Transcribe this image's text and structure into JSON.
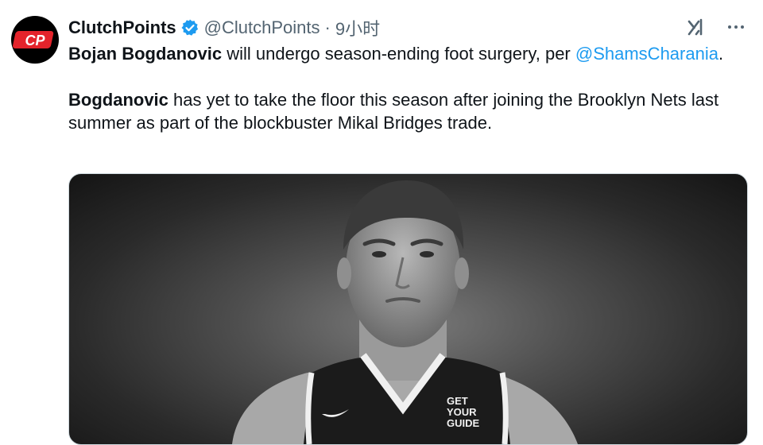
{
  "author": {
    "name": "ClutchPoints",
    "handle": "@ClutchPoints",
    "separator": "·",
    "time": "9小时",
    "avatar_text": "CP"
  },
  "icons": {
    "verified": "verified-badge-icon",
    "grok": "grok-icon",
    "more": "more-options-icon"
  },
  "colors": {
    "verified_blue": "#1d9bf0",
    "mention_blue": "#1d9bf0",
    "avatar_red": "#e4232b"
  },
  "tweet": {
    "p1_bold": "Bojan Bogdanovic",
    "p1_text": " will undergo season-ending foot surgery, per ",
    "p1_mention": "@ShamsCharania",
    "p1_end": ".",
    "p2_bold": "Bogdanovic",
    "p2_text": " has yet to take the floor this season after joining the Brooklyn Nets last summer as part of the blockbuster Mikal Bridges trade."
  },
  "media": {
    "jersey_patch": [
      "GET",
      "YOUR",
      "GUIDE"
    ]
  }
}
